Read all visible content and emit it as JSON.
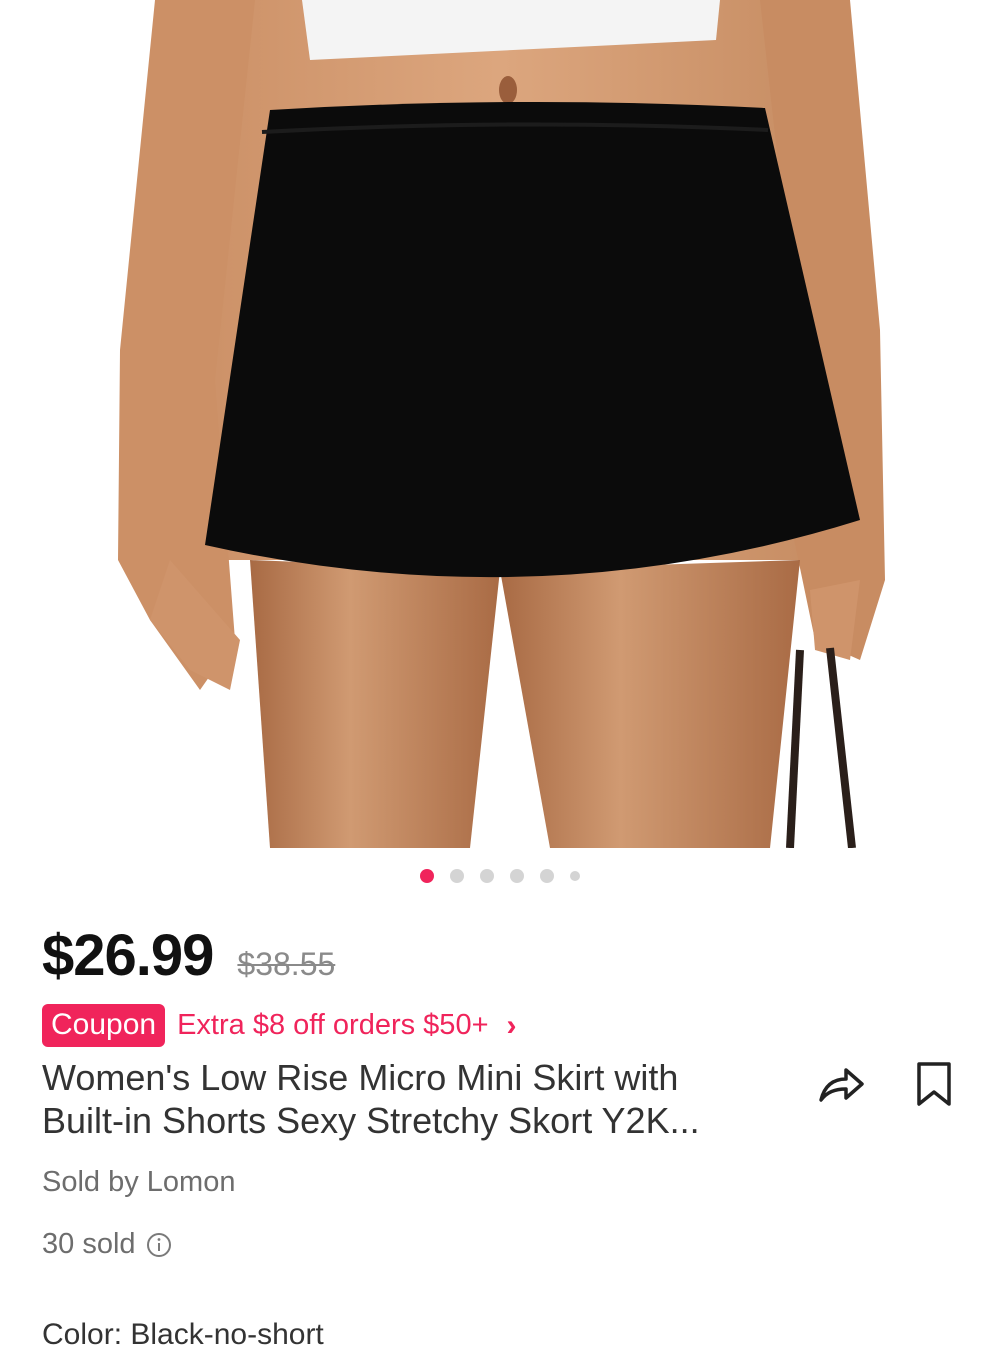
{
  "gallery": {
    "image_count": 6,
    "active_index": 0,
    "image_alt": "product-photo-black-mini-skort"
  },
  "price": {
    "current": "$26.99",
    "original": "$38.55"
  },
  "coupon": {
    "badge": "Coupon",
    "text": "Extra $8 off orders $50+",
    "chevron": "›"
  },
  "product": {
    "title_line1": "Women's Low Rise Micro Mini Skirt with",
    "title_line2": "Built-in Shorts Sexy Stretchy Skort Y2K..."
  },
  "actions": {
    "share_icon": "share-icon",
    "bookmark_icon": "bookmark-icon"
  },
  "seller": {
    "text": "Sold by Lomon"
  },
  "sales": {
    "text": "30 sold",
    "info_icon": "info-icon"
  },
  "cut_off_row": {
    "text": "Color: Black-no-short"
  },
  "colors": {
    "accent": "#f0245b",
    "text": "#333333",
    "muted": "#6d6d6d"
  }
}
